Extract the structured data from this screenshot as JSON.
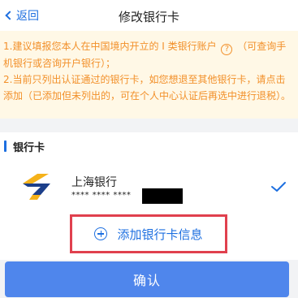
{
  "nav": {
    "back_label": "返回",
    "title": "修改银行卡"
  },
  "notice": {
    "line1_before": "1.建议填报您本人在中国境内开立的 I 类银行账户",
    "help_icon_glyph": "?",
    "line1_after": "（可查询手机银行或咨询开户银行）；",
    "line2": "2.当前只列出认证通过的银行卡，如您想退至其他银行卡，请点击添加（已添加但未列出的，可在个人中心认证后再选中进行退税）。"
  },
  "section": {
    "title": "银行卡"
  },
  "bank_card": {
    "name": "上海银行",
    "masked_number": "**** **** ****",
    "selected": true,
    "logo_icon": "bank-of-shanghai-logo",
    "check_icon": "checkmark"
  },
  "add_card": {
    "label": "添加银行卡信息",
    "icon": "plus-circle"
  },
  "confirm": {
    "label": "确认"
  },
  "colors": {
    "accent": "#1d6fe0",
    "notice_text": "#f2902a",
    "notice_bg": "#fff8e6",
    "highlight_border": "#e0404e",
    "button_bg": "#4f86ec",
    "logo_dark": "#1c3f8a",
    "logo_yellow": "#f5b21a"
  }
}
